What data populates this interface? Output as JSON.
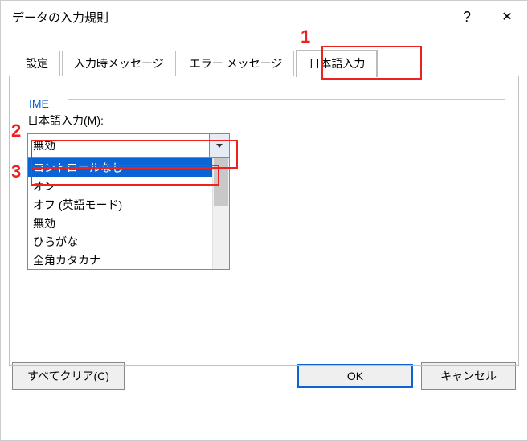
{
  "title": "データの入力規則",
  "help": "?",
  "annotations": {
    "n1": "1",
    "n2": "2",
    "n3": "3"
  },
  "tabs": {
    "settings": "設定",
    "input_msg": "入力時メッセージ",
    "error_msg": "エラー メッセージ",
    "ime": "日本語入力"
  },
  "fieldset": {
    "legend": "IME"
  },
  "field": {
    "label": "日本語入力(M):",
    "value": "無効",
    "options": {
      "o0": "コントロールなし",
      "o1": "オン",
      "o2": "オフ (英語モード)",
      "o3": "無効",
      "o4": "ひらがな",
      "o5": "全角カタカナ"
    }
  },
  "buttons": {
    "clear": "すべてクリア(C)",
    "ok": "OK",
    "cancel": "キャンセル"
  }
}
